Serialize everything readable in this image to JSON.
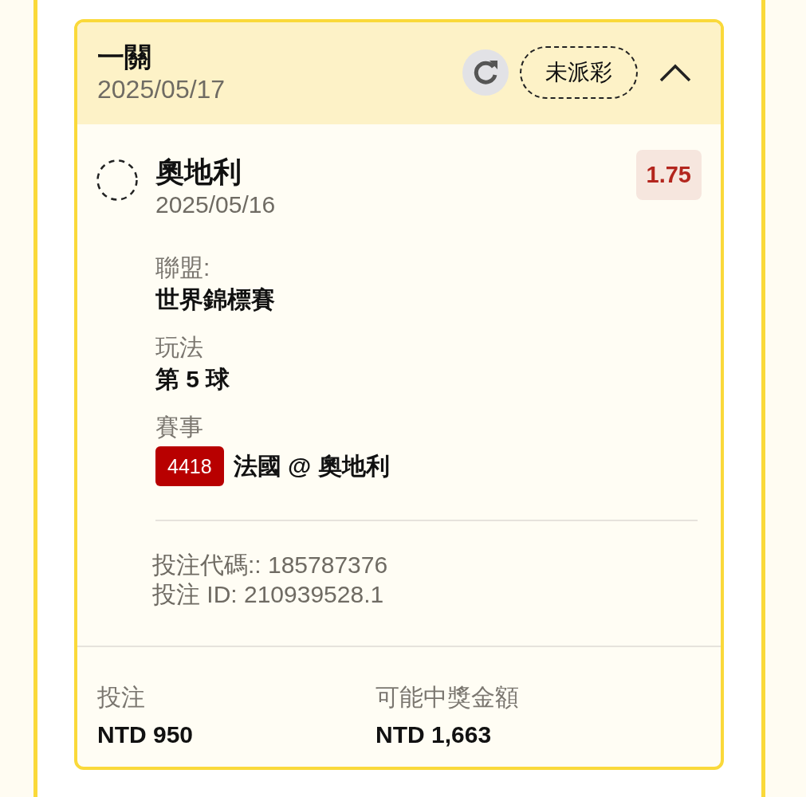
{
  "bet_card": {
    "header": {
      "title": "一關",
      "date": "2025/05/17",
      "status": "未派彩",
      "expanded": true
    },
    "selection": {
      "name": "奧地利",
      "date": "2025/05/16",
      "odds": "1.75"
    },
    "details": [
      {
        "kind": "text",
        "label": "聯盟:",
        "value": "世界錦標賽"
      },
      {
        "kind": "text",
        "label": "玩法",
        "value": "第 5 球"
      },
      {
        "kind": "match",
        "label": "賽事",
        "match_code": "4418",
        "value": "法國 @ 奧地利"
      }
    ],
    "references": [
      "投注代碼:: 185787376",
      "投注 ID: 210939528.1"
    ],
    "summary": [
      {
        "label": "投注",
        "value": "NTD 950"
      },
      {
        "label": "可能中獎金額",
        "value": "NTD 1,663"
      }
    ]
  }
}
